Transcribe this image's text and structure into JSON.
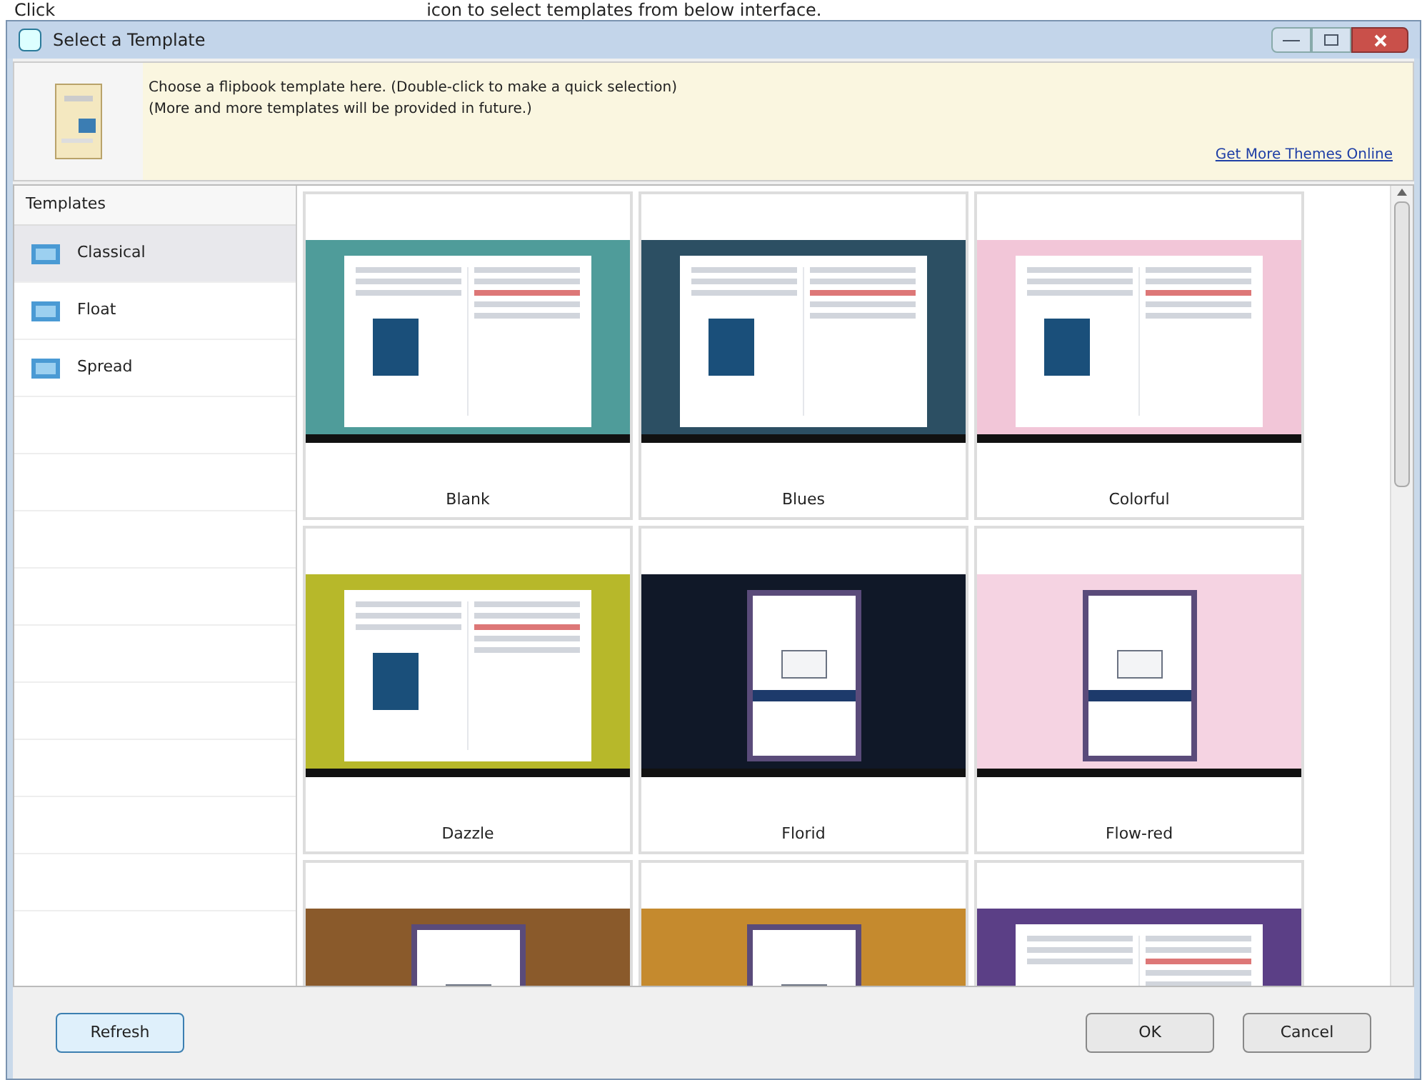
{
  "caption": {
    "lead": "Click",
    "rest": "icon to select templates from below interface."
  },
  "window": {
    "title": "Select a Template"
  },
  "banner": {
    "lines": [
      "Choose a flipbook template here. (Double-click to make a quick selection)",
      "(More and more templates will be provided in future.)"
    ],
    "link": "Get More Themes Online"
  },
  "sidebar": {
    "header": "Templates",
    "items": [
      {
        "label": "Classical",
        "selected": true
      },
      {
        "label": "Float",
        "selected": false
      },
      {
        "label": "Spread",
        "selected": false
      }
    ]
  },
  "templates": [
    {
      "name": "Blank",
      "kind": "spread",
      "color": "#4f9c9a"
    },
    {
      "name": "Blues",
      "kind": "spread",
      "color": "#2c4f63"
    },
    {
      "name": "Colorful",
      "kind": "spread",
      "color": "#f2c6d8"
    },
    {
      "name": "Dazzle",
      "kind": "spread",
      "color": "#b7b82a"
    },
    {
      "name": "Florid",
      "kind": "float",
      "color": "#101828"
    },
    {
      "name": "Flow-red",
      "kind": "float",
      "color": "#f5d3e2"
    },
    {
      "kind": "float",
      "color": "#8a5a2b"
    },
    {
      "kind": "float",
      "color": "#c58a2e"
    },
    {
      "kind": "spread",
      "color": "#5b3f86"
    }
  ],
  "buttons": {
    "refresh": "Refresh",
    "ok": "OK",
    "cancel": "Cancel"
  }
}
